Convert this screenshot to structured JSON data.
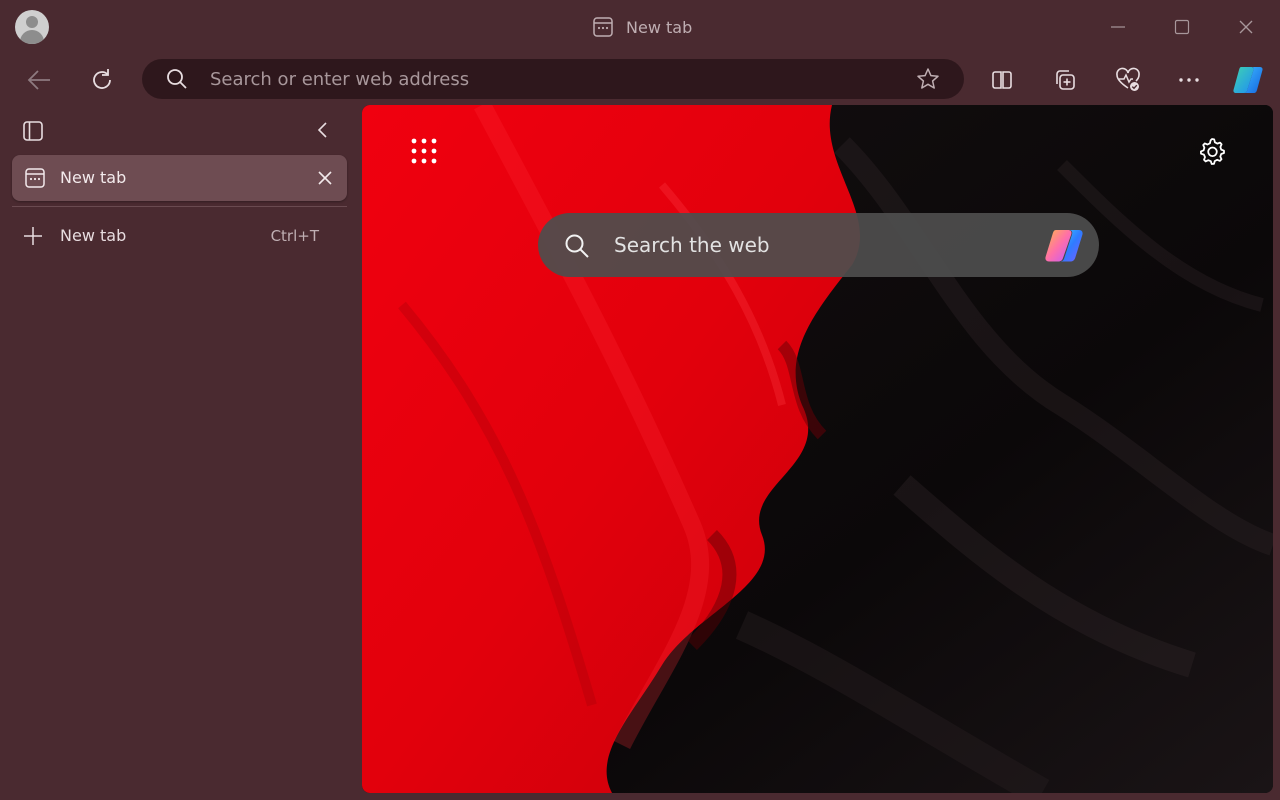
{
  "window": {
    "title": "New tab"
  },
  "toolbar": {
    "address_placeholder": "Search or enter web address"
  },
  "sidebar": {
    "tabs": [
      {
        "label": "New tab",
        "active": true
      }
    ],
    "new_tab": {
      "label": "New tab",
      "shortcut": "Ctrl+T"
    }
  },
  "content": {
    "search_placeholder": "Search the web"
  },
  "colors": {
    "frame": "#4a2a30",
    "active_tab": "#6e4c52",
    "address_bg": "#2e171c",
    "wallpaper_red": "#e8000e",
    "wallpaper_black": "#0b0809"
  },
  "icons": {
    "profile": "avatar",
    "tab_favicon": "new-tab-page-icon",
    "minimize": "minimize-icon",
    "maximize": "maximize-icon",
    "close": "close-icon",
    "back": "back-arrow-icon",
    "refresh": "refresh-icon",
    "search": "search-icon",
    "favorite": "star-icon",
    "split_screen": "split-screen-icon",
    "collections": "collections-icon",
    "browser_essentials": "heart-pulse-icon",
    "more": "more-icon",
    "copilot": "copilot-icon",
    "tab_actions": "tab-actions-icon",
    "collapse": "chevron-left-icon",
    "new_tab": "plus-icon",
    "apps": "app-launcher-icon",
    "settings": "gear-icon"
  }
}
